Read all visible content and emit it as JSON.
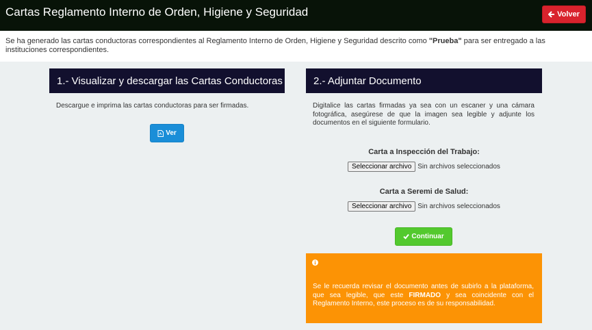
{
  "header": {
    "title": "Cartas Reglamento Interno de Orden, Higiene y Seguridad",
    "back_label": "Volver"
  },
  "notice": {
    "before": "Se ha generado las cartas conductoras correspondientes al Reglamento Interno de Orden, Higiene y Seguridad descrito como ",
    "highlight": "\"Prueba\"",
    "after": " para ser entregado a las instituciones correspondientes."
  },
  "download_panel": {
    "title": "1.- Visualizar y descargar las Cartas Conductoras",
    "description": "Descargue e imprima las cartas conductoras para ser firmadas.",
    "view_label": "Ver"
  },
  "upload_panel": {
    "title": "2.- Adjuntar Documento",
    "description": "Digitalice las cartas firmadas ya sea con un escaner y una cámara fotográfica, asegúrese de que la imagen sea legible y adjunte los documentos en el siguiente formulario.",
    "fields": [
      {
        "label": "Carta a Inspección del Trabajo:",
        "button": "Seleccionar archivo",
        "status": "Sin archivos seleccionados"
      },
      {
        "label": "Carta a Seremi de Salud:",
        "button": "Seleccionar archivo",
        "status": "Sin archivos seleccionados"
      }
    ],
    "continue_label": "Continuar"
  },
  "alert": {
    "icon": "info-circle-icon",
    "before": "Se le recuerda revisar el documento antes de subirlo a la plataforma, que sea legible, que este ",
    "highlight": "FIRMADO",
    "after": " y sea coincidente con el Reglamento Interno, este proceso es de su responsabilidad."
  },
  "colors": {
    "topbar": "#081308",
    "panel_header": "#12102e",
    "back_button": "#d9232d",
    "view_button": "#1a8ed8",
    "continue_button": "#53c92e",
    "alert": "#fc9305"
  }
}
